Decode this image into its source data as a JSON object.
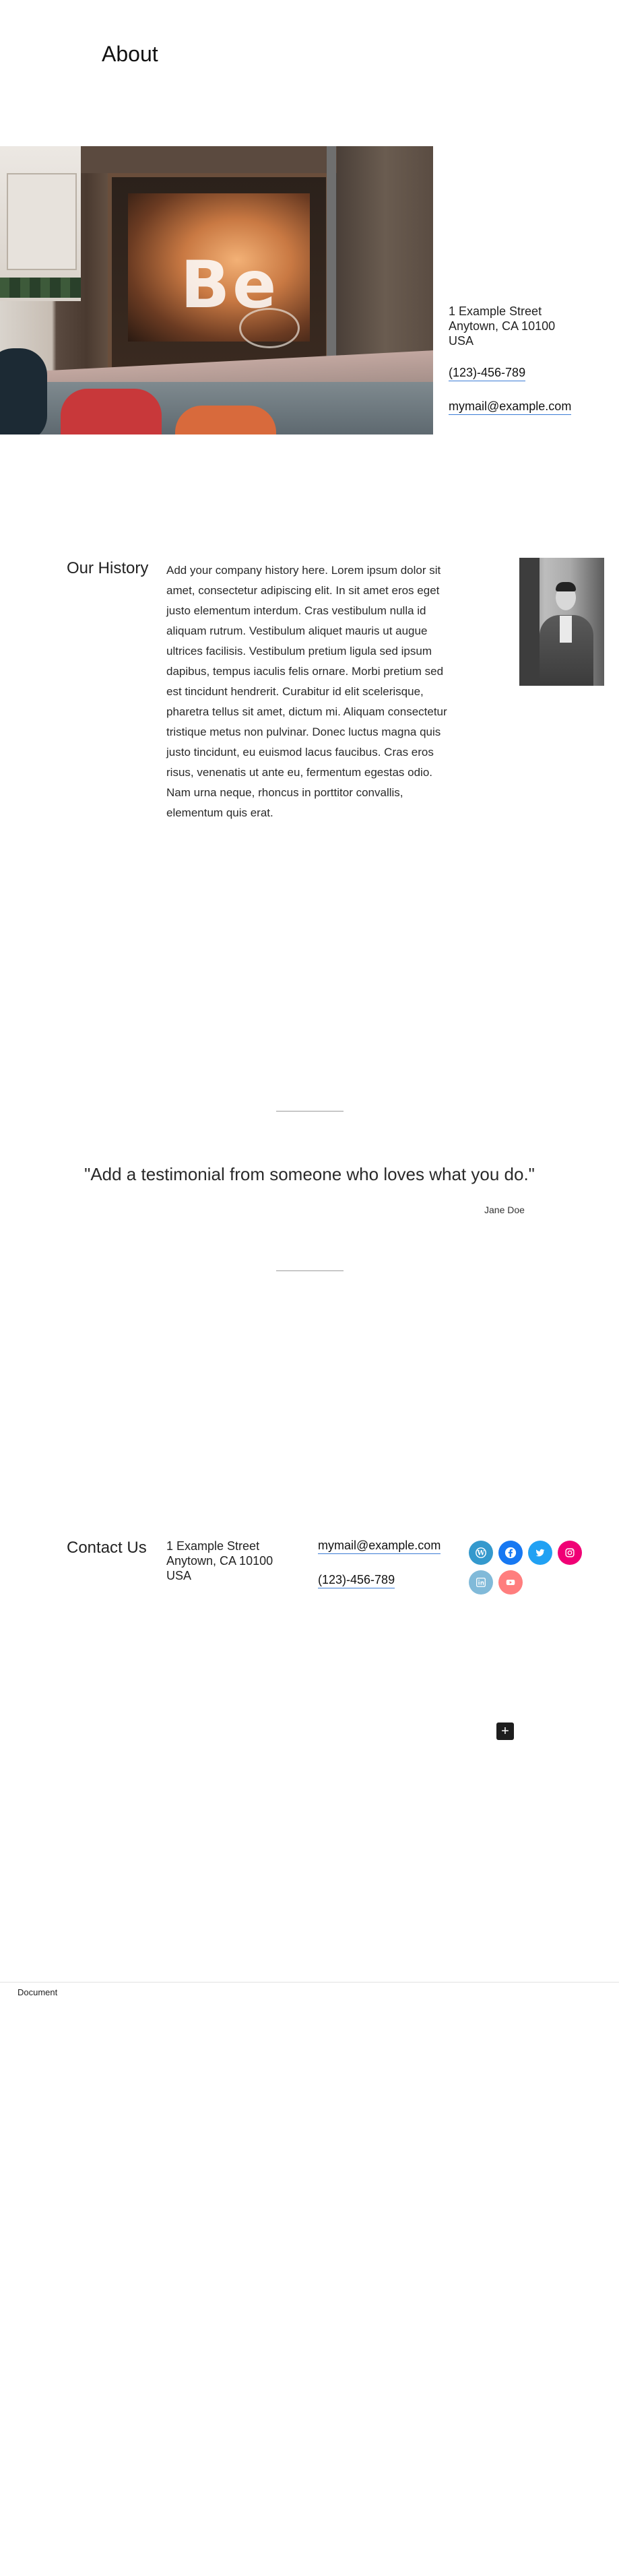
{
  "page": {
    "title": "About"
  },
  "hero": {
    "address": {
      "line1": "1 Example Street",
      "line2": "Anytown, CA 10100",
      "line3": "USA"
    },
    "phone": "(123)-456-789",
    "email": "mymail@example.com",
    "image_sign_text": "Be"
  },
  "history": {
    "heading": "Our History",
    "body": "Add your company history here. Lorem ipsum dolor sit amet, consectetur adipiscing elit. In sit amet eros eget justo elementum interdum. Cras vestibulum nulla id aliquam rutrum. Vestibulum aliquet mauris ut augue ultrices facilisis. Vestibulum pretium ligula sed ipsum dapibus, tempus iaculis felis ornare. Morbi pretium sed est tincidunt hendrerit. Curabitur id elit scelerisque, pharetra tellus sit amet, dictum mi. Aliquam consectetur tristique metus non pulvinar. Donec luctus magna quis justo tincidunt, eu euismod lacus faucibus. Cras eros risus, venenatis ut ante eu, fermentum egestas odio. Nam urna neque, rhoncus in porttitor convallis, elementum quis erat."
  },
  "testimonial": {
    "quote": "\"Add a testimonial from someone who loves what you do.\"",
    "author": "Jane Doe"
  },
  "contact": {
    "heading": "Contact Us",
    "address": {
      "line1": "1 Example Street",
      "line2": "Anytown, CA 10100",
      "line3": "USA"
    },
    "email": "mymail@example.com",
    "phone": "(123)-456-789",
    "social": [
      {
        "name": "wordpress-icon",
        "color": "#3499cd"
      },
      {
        "name": "facebook-icon",
        "color": "#1778f2"
      },
      {
        "name": "twitter-icon",
        "color": "#21a1f3"
      },
      {
        "name": "instagram-icon",
        "color": "#f00075"
      },
      {
        "name": "linkedin-icon",
        "color": "#0577b5"
      },
      {
        "name": "youtube-icon",
        "color": "#ff0000"
      }
    ]
  },
  "editor": {
    "add_block_label": "+"
  },
  "footer": {
    "breadcrumb": "Document"
  }
}
